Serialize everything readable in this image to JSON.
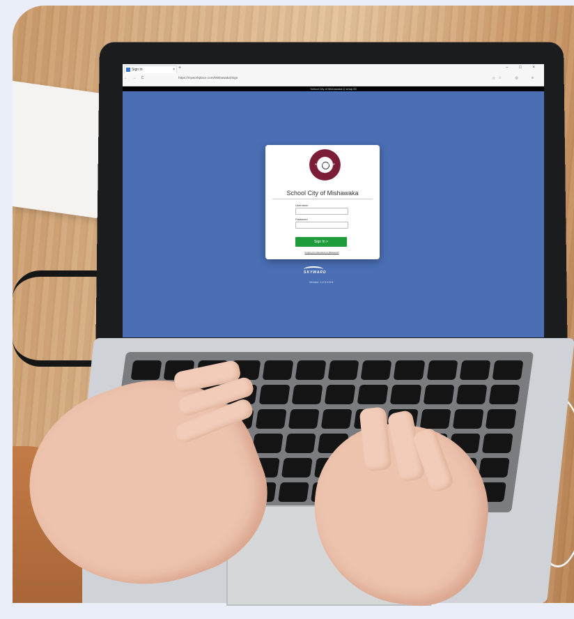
{
  "browser": {
    "tab_title": "Sign In",
    "tab_close": "×",
    "new_tab": "+",
    "nav_buttons": "← → C",
    "url": "https://myworkplace.com/Mishawaka/Sign",
    "window_title": "School City of Mishawaka Q setup 00",
    "window_controls": "– □ ×",
    "toolbar_icons": "☆ ◎ ≡"
  },
  "login": {
    "institution": "School City of Mishawaka",
    "seal_text": "SCHOOL CITY OF MISHAWAKA INDIANA",
    "username_label": "Username",
    "password_label": "Password",
    "sign_in_label": "Sign In >",
    "forgot_link": "Forgot your Username or Password?"
  },
  "footer": {
    "logo_text": "SKYWARD",
    "version": "Version: 1.2.3.4.5.6"
  }
}
